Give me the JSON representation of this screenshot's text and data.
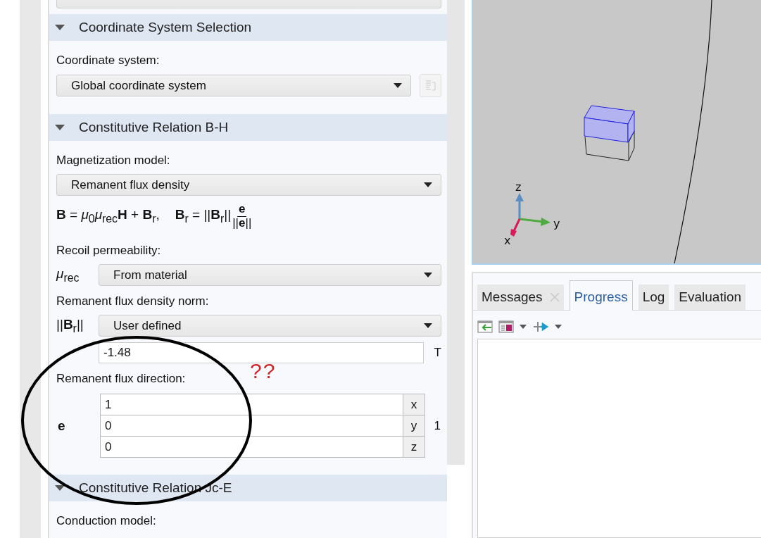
{
  "settings": {
    "sections": [
      {
        "title": "Coordinate System Selection",
        "expanded": true,
        "items": [
          {
            "kind": "label",
            "text": "Coordinate system:"
          },
          {
            "kind": "dropdown",
            "value": "Global coordinate system",
            "side_button": true
          }
        ]
      },
      {
        "title": "Constitutive Relation B-H",
        "expanded": true,
        "items": [
          {
            "kind": "label",
            "text": "Magnetization model:"
          },
          {
            "kind": "dropdown",
            "value": "Remanent flux density",
            "side_button": false
          },
          {
            "kind": "equation",
            "left": "**B** = *μ*$_{0}$*μ*$_{rec}$**H** + **B**$_{r}$,",
            "right": "**B**$_{r}$ = ||**B**$_{r}$||",
            "numerator": "**e**",
            "denominator": "||**e**||"
          },
          {
            "kind": "label",
            "text": "Recoil permeability:"
          },
          {
            "kind": "symbol_dropdown",
            "symbol": "*μ*$_{rec}$",
            "value": "From material"
          },
          {
            "kind": "label",
            "text": "Remanent flux density norm:"
          },
          {
            "kind": "symbol_dropdown",
            "symbol": "||**B**$_{r}$||",
            "value": "User defined"
          },
          {
            "kind": "field",
            "value": "-1.48",
            "unit": "T"
          },
          {
            "kind": "label",
            "text": "Remanent flux direction:"
          },
          {
            "kind": "vector",
            "symbol": "e",
            "unit": "1",
            "components": [
              {
                "value": "1",
                "axis": "x"
              },
              {
                "value": "0",
                "axis": "y"
              },
              {
                "value": "0",
                "axis": "z"
              }
            ]
          }
        ]
      },
      {
        "title": "Constitutive Relation Jc-E",
        "expanded": true,
        "items": [
          {
            "kind": "label",
            "text": "Conduction model:"
          }
        ]
      }
    ]
  },
  "annotation": {
    "text": "??"
  },
  "graphics": {
    "axis_labels": {
      "z": "z",
      "y": "y",
      "x": "x"
    }
  },
  "messages_panel": {
    "tabs": [
      {
        "label": "Messages",
        "closable": true,
        "selected": false
      },
      {
        "label": "Progress",
        "closable": false,
        "selected": true
      },
      {
        "label": "Log",
        "closable": false,
        "selected": false
      },
      {
        "label": "Evaluation",
        "closable": false,
        "selected": false
      }
    ]
  }
}
